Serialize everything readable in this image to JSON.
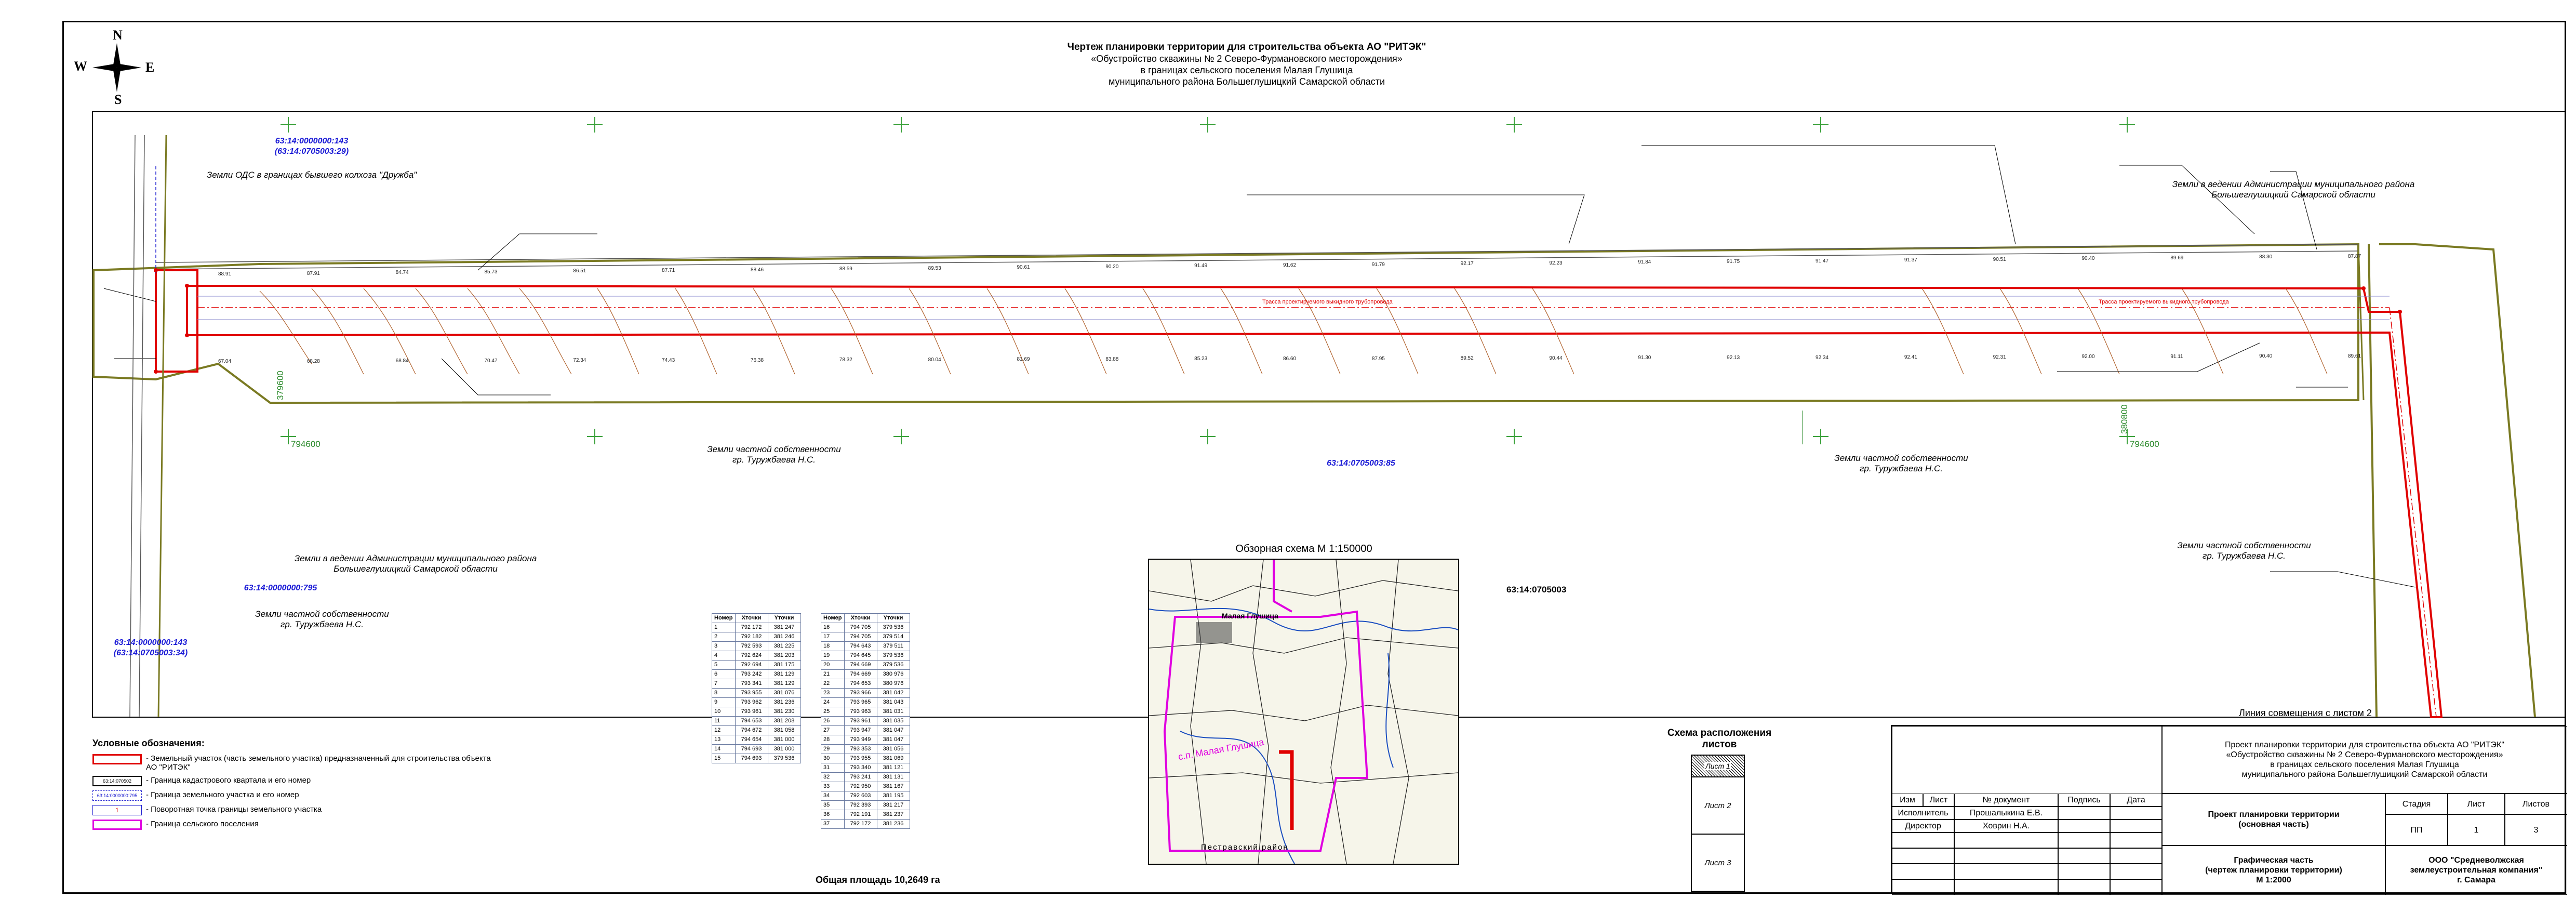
{
  "title": {
    "line1": "Чертеж планировки территории для строительства объекта АО \"РИТЭК\"",
    "line2": "«Обустройство скважины № 2 Северо-Фурмановского месторождения»",
    "line3": "в границах сельского поселения Малая Глушица",
    "line4": "муниципального района Большеглушицкий Самарской области"
  },
  "compass": {
    "n": "N",
    "s": "S",
    "w": "W",
    "e": "E"
  },
  "labels": {
    "cad1": "63:14:0000000:143",
    "cad1b": "(63:14:0705003:29)",
    "zemli_ods": "Земли ОДС в границах бывшего колхоза \"Дружба\"",
    "admin1_l1": "Земли в ведении Администрации муниципального района",
    "admin1_l2": "Большеглушицкий Самарской области",
    "admin2_l1": "Земли в ведении Администрации муниципального района",
    "admin2_l2": "Большеглушицкий Самарской области",
    "cad795": "63:14:0000000:795",
    "private1_l1": "Земли частной собственности",
    "private1_l2": "гр. Туружбаева Н.С.",
    "cad143b": "63:14:0000000:143",
    "cad143b2": "(63:14:0705003:34)",
    "private2_l1": "Земли частной собственности",
    "private2_l2": "гр. Туружбаева Н.С.",
    "cad85": "63:14:0705003:85",
    "private3_l1": "Земли частной собственности",
    "private3_l2": "гр. Туружбаева Н.С.",
    "private4_l1": "Земли частной собственности",
    "private4_l2": "гр. Туружбаева Н.С.",
    "cad_quarter": "63:14:0705003",
    "grid1": "379600",
    "grid2": "794600",
    "grid3": "380800",
    "grid4": "794600",
    "align_line": "Линия совмещения с листом 2",
    "trassa1": "Трасса проектируемого выкидного трубопровода",
    "trassa2": "Трасса проектируемого выкидного трубопровода"
  },
  "elevations_top": [
    "88.91",
    "87.91",
    "84.74",
    "85.73",
    "86.51",
    "87.71",
    "88.46",
    "88.59",
    "89.53",
    "90.61",
    "90.20",
    "91.49",
    "91.62",
    "91.79",
    "92.17",
    "92.23",
    "91.84",
    "91.75",
    "91.47",
    "91.37",
    "90.51",
    "90.40",
    "89.69",
    "88.30",
    "87.87"
  ],
  "elevations_bot": [
    "67.04",
    "68.28",
    "68.84",
    "70.47",
    "72.34",
    "74.43",
    "76.38",
    "78.32",
    "80.04",
    "81.69",
    "83.88",
    "85.23",
    "86.60",
    "87.95",
    "89.52",
    "90.44",
    "91.30",
    "92.13",
    "92.34",
    "92.41",
    "92.31",
    "92.00",
    "91.11",
    "90.40",
    "89.61"
  ],
  "table1": {
    "headers": [
      "Номер",
      "Xточки",
      "Yточки"
    ],
    "rows": [
      [
        "1",
        "792 172",
        "381 247"
      ],
      [
        "2",
        "792 182",
        "381 246"
      ],
      [
        "3",
        "792 593",
        "381 225"
      ],
      [
        "4",
        "792 624",
        "381 203"
      ],
      [
        "5",
        "792 694",
        "381 175"
      ],
      [
        "6",
        "793 242",
        "381 129"
      ],
      [
        "7",
        "793 341",
        "381 129"
      ],
      [
        "8",
        "793 955",
        "381 076"
      ],
      [
        "9",
        "793 962",
        "381 236"
      ],
      [
        "10",
        "793 961",
        "381 230"
      ],
      [
        "11",
        "794 653",
        "381 208"
      ],
      [
        "12",
        "794 672",
        "381 058"
      ],
      [
        "13",
        "794 654",
        "381 000"
      ],
      [
        "14",
        "794 693",
        "381 000"
      ],
      [
        "15",
        "794 693",
        "379 536"
      ]
    ]
  },
  "table2": {
    "headers": [
      "Номер",
      "Xточки",
      "Yточки"
    ],
    "rows": [
      [
        "16",
        "794 705",
        "379 536"
      ],
      [
        "17",
        "794 705",
        "379 514"
      ],
      [
        "18",
        "794 643",
        "379 511"
      ],
      [
        "19",
        "794 645",
        "379 536"
      ],
      [
        "20",
        "794 669",
        "379 536"
      ],
      [
        "21",
        "794 669",
        "380 976"
      ],
      [
        "22",
        "794 653",
        "380 976"
      ],
      [
        "23",
        "793 966",
        "381 042"
      ],
      [
        "24",
        "793 965",
        "381 043"
      ],
      [
        "25",
        "793 963",
        "381 031"
      ],
      [
        "26",
        "793 961",
        "381 035"
      ],
      [
        "27",
        "793 947",
        "381 047"
      ],
      [
        "28",
        "793 949",
        "381 047"
      ],
      [
        "29",
        "793 353",
        "381 056"
      ],
      [
        "30",
        "793 955",
        "381 069"
      ],
      [
        "31",
        "793 340",
        "381 121"
      ],
      [
        "32",
        "793 241",
        "381 131"
      ],
      [
        "33",
        "792 950",
        "381 167"
      ],
      [
        "34",
        "792 603",
        "381 195"
      ],
      [
        "35",
        "792 393",
        "381 217"
      ],
      [
        "36",
        "792 191",
        "381 237"
      ],
      [
        "37",
        "792 172",
        "381 236"
      ]
    ]
  },
  "legend": {
    "title": "Условные обозначения:",
    "items": [
      {
        "text": "- Земельный участок (часть земельного участка) предназначенный для строительства объекта АО \"РИТЭК\"",
        "sym": ""
      },
      {
        "text": "- Граница кадастрового квартала и его номер",
        "sym": "63:14:070502"
      },
      {
        "text": "- Граница земельного участка и его номер",
        "sym": "63:14:0000000:795"
      },
      {
        "text": "- Поворотная точка границы земельного участка",
        "sym": "1"
      },
      {
        "text": "- Граница сельского поселения",
        "sym": ""
      }
    ]
  },
  "overview": {
    "title": "Обзорная схема М 1:150000",
    "village": "с.п. Малая Глушица",
    "town": "Малая Глушица",
    "district": "Пестравский район"
  },
  "sheets": {
    "title": "Схема расположения листов",
    "current": "Лист 1",
    "s2": "Лист 2",
    "s3": "Лист 3"
  },
  "total_area": "Общая площадь 10,2649 га",
  "stamp": {
    "project_l1": "Проект планировки территории для строительства объекта АО \"РИТЭК\"",
    "project_l2": "«Обустройство скважины № 2 Северо-Фурмановского месторождения»",
    "project_l3": "в границах сельского поселения Малая Глушица",
    "project_l4": "муниципального района Большеглушицкий Самарской области",
    "izm": "Изм",
    "list": "Лист",
    "ndoc": "№ документ",
    "podp": "Подпись",
    "data": "Дата",
    "ispolnitel": "Исполнитель",
    "ispolnitel_name": "Прошалыкина Е.В.",
    "direktor": "Директор",
    "direktor_name": "Ховрин Н.А.",
    "main_l1": "Проект планировки территории",
    "main_l2": "(основная часть)",
    "stadia": "Стадия",
    "list_h": "Лист",
    "listov": "Листов",
    "stadia_v": "ПП",
    "list_v": "1",
    "listov_v": "3",
    "graph_l1": "Графическая часть",
    "graph_l2": "(чертеж планировки территории)",
    "graph_l3": "М 1:2000",
    "org_l1": "ООО \"Средневолжская",
    "org_l2": "землеустроительная компания\"",
    "org_l3": "г. Самара"
  }
}
